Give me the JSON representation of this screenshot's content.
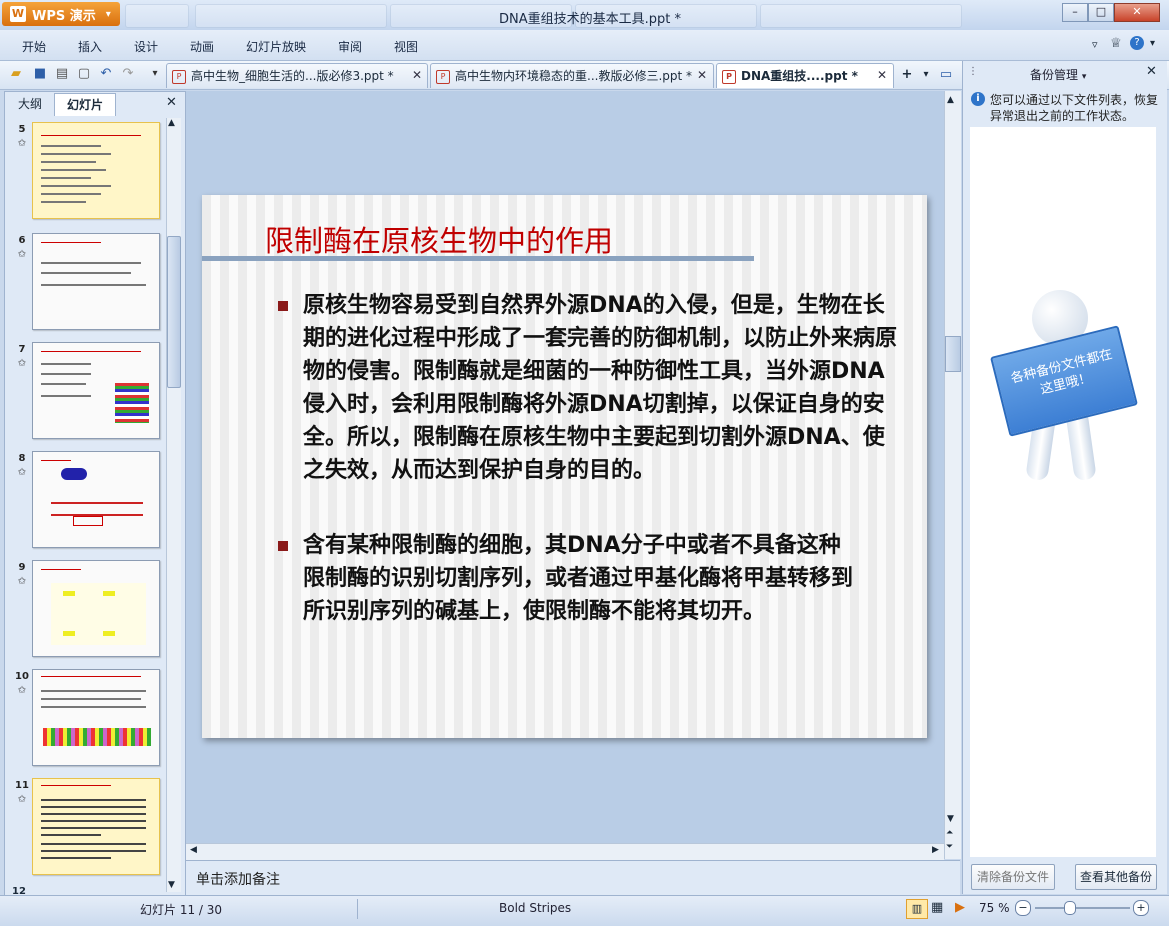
{
  "app": {
    "brand": "WPS 演示",
    "window_title": "DNA重组技术的基本工具.ppt *"
  },
  "menu": [
    "开始",
    "插入",
    "设计",
    "动画",
    "幻灯片放映",
    "审阅",
    "视图"
  ],
  "doc_tabs": [
    {
      "label": "高中生物_细胞生活的...版必修3.ppt *",
      "active": false
    },
    {
      "label": "高中生物内环境稳态的重...教版必修三.ppt *",
      "active": false
    },
    {
      "label": "DNA重组技....ppt *",
      "active": true
    }
  ],
  "left_panel": {
    "tabs": [
      "大纲",
      "幻灯片"
    ],
    "active_tab": "幻灯片",
    "slides": [
      {
        "num": "5",
        "title": "基因工程的基本工具"
      },
      {
        "num": "6",
        "title": "DNA重组技术的基本工具"
      },
      {
        "num": "7",
        "title": "限制性核酸内切酶"
      },
      {
        "num": "8",
        "title": "限制酶的切割"
      },
      {
        "num": "9",
        "title": "限制酶的作用"
      },
      {
        "num": "10",
        "title": "限制酶识别的序列特点"
      },
      {
        "num": "11",
        "title": "限制酶在原核生物中的作用"
      }
    ],
    "selected": "11"
  },
  "slide": {
    "title": "限制酶在原核生物中的作用",
    "bullets": [
      "原核生物容易受到自然界外源DNA的入侵，但是，生物在长期的进化过程中形成了一套完善的防御机制，以防止外来病原物的侵害。限制酶就是细菌的一种防御性工具，当外源DNA侵入时，会利用限制酶将外源DNA切割掉，以保证自身的安全。所以，限制酶在原核生物中主要起到切割外源DNA、使之失效，从而达到保护自身的目的。",
      "含有某种限制酶的细胞，其DNA分子中或者不具备这种限制酶的识别切割序列，或者通过甲基化酶将甲基转移到所识别序列的碱基上，使限制酶不能将其切开。"
    ]
  },
  "notes_placeholder": "单击添加备注",
  "backup_panel": {
    "title": "备份管理",
    "info": "您可以通过以下文件列表，恢复异常退出之前的工作状态。",
    "sign_text": "各种备份文件都在这里哦！",
    "clear_button": "清除备份文件",
    "other_button": "查看其他备份"
  },
  "status": {
    "slide_counter": "幻灯片 11 / 30",
    "theme": "Bold Stripes",
    "zoom": "75 %"
  },
  "colors": {
    "accent": "#c00000",
    "bullet": "#8b1a1a",
    "brand": "#e0801f"
  }
}
